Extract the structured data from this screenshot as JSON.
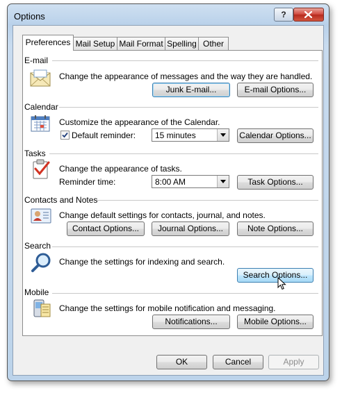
{
  "window": {
    "title": "Options",
    "help_label": "?"
  },
  "tabs": [
    {
      "label": "Preferences",
      "active": true
    },
    {
      "label": "Mail Setup"
    },
    {
      "label": "Mail Format"
    },
    {
      "label": "Spelling"
    },
    {
      "label": "Other"
    }
  ],
  "sections": {
    "email": {
      "title": "E-mail",
      "icon": "envelope-icon",
      "description": "Change the appearance of messages and the way they are handled.",
      "buttons": {
        "junk": "Junk E-mail...",
        "options": "E-mail Options..."
      }
    },
    "calendar": {
      "title": "Calendar",
      "icon": "calendar-icon",
      "description": "Customize the appearance of the Calendar.",
      "reminder_label": "Default reminder:",
      "reminder_checked": true,
      "reminder_value": "15 minutes",
      "buttons": {
        "options": "Calendar Options..."
      }
    },
    "tasks": {
      "title": "Tasks",
      "icon": "task-clipboard-icon",
      "description": "Change the appearance of tasks.",
      "reminder_label": "Reminder time:",
      "reminder_value": "8:00 AM",
      "buttons": {
        "options": "Task Options..."
      }
    },
    "contacts": {
      "title": "Contacts and Notes",
      "icon": "contact-card-icon",
      "description": "Change default settings for contacts, journal, and notes.",
      "buttons": {
        "contact": "Contact Options...",
        "journal": "Journal Options...",
        "note": "Note Options..."
      }
    },
    "search": {
      "title": "Search",
      "icon": "magnifier-icon",
      "description": "Change the settings for indexing and search.",
      "buttons": {
        "options": "Search Options..."
      }
    },
    "mobile": {
      "title": "Mobile",
      "icon": "mobile-device-icon",
      "description": "Change the settings for mobile notification and messaging.",
      "buttons": {
        "notifications": "Notifications...",
        "options": "Mobile Options..."
      }
    }
  },
  "footer": {
    "ok": "OK",
    "cancel": "Cancel",
    "apply": "Apply"
  }
}
